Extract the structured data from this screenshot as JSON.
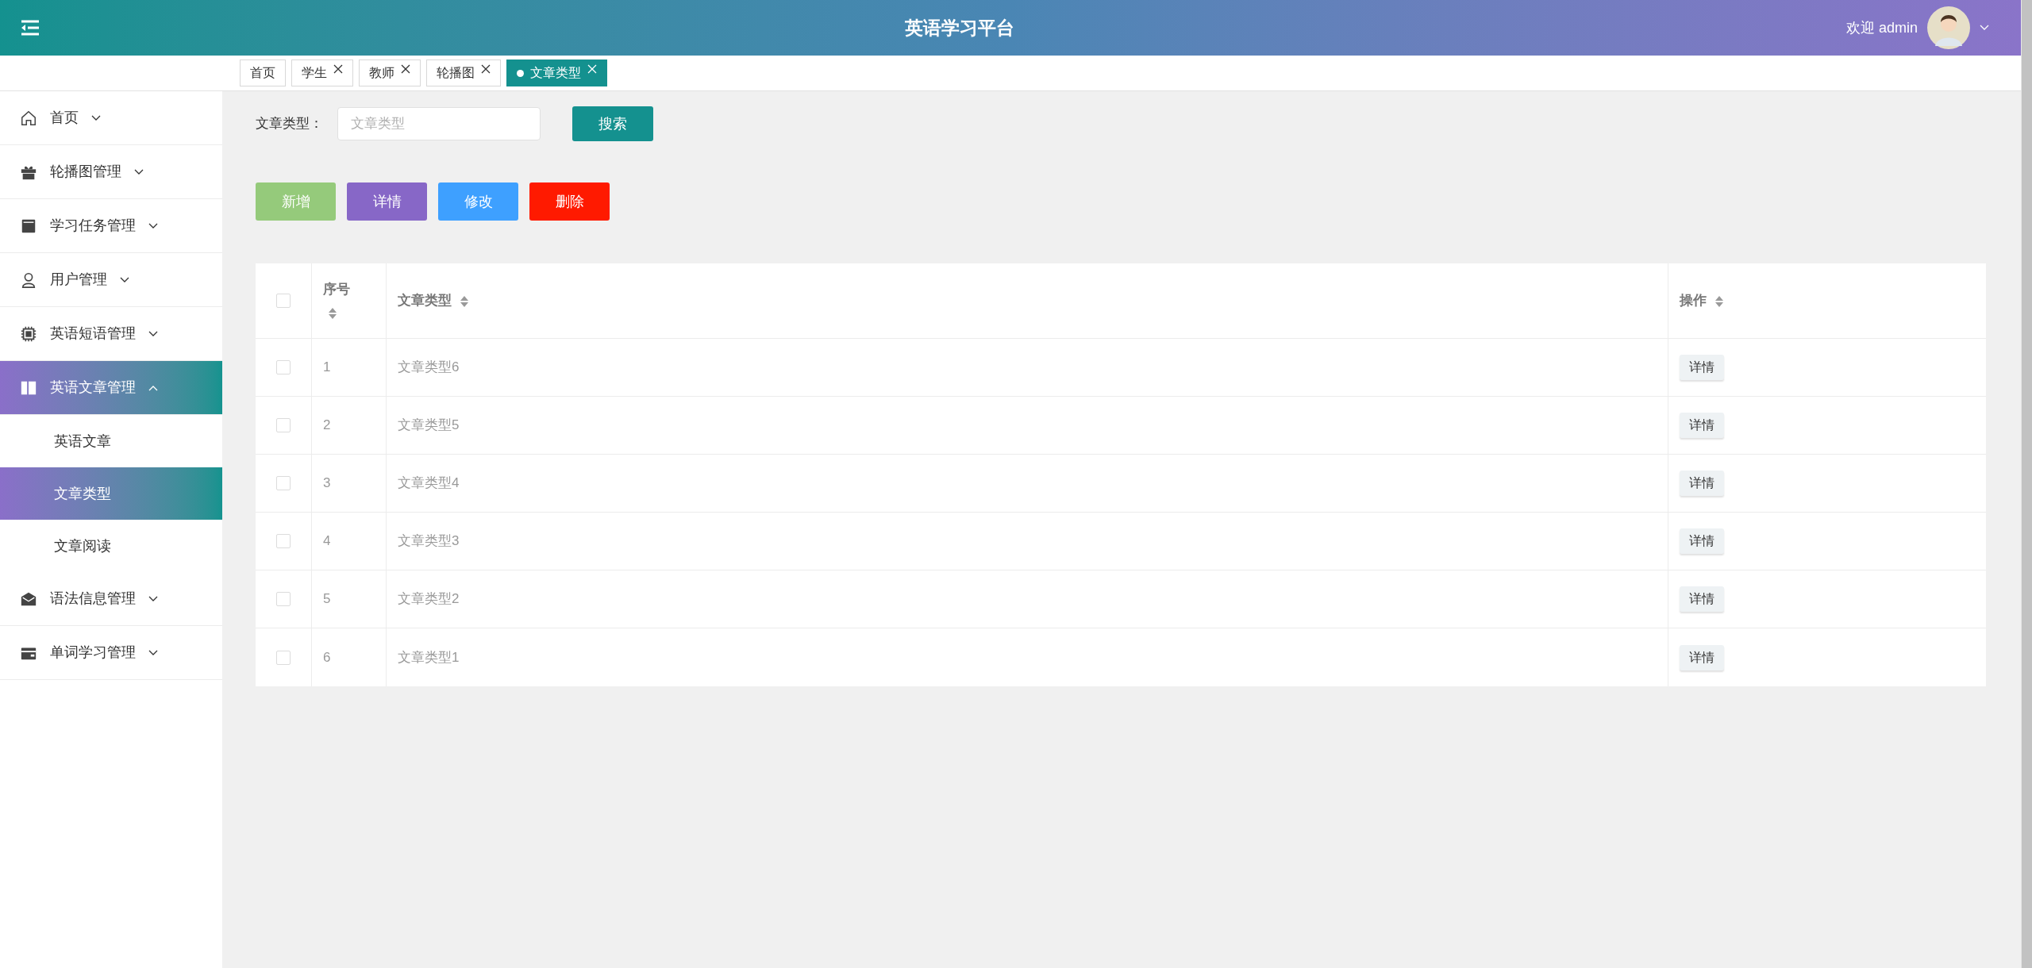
{
  "header": {
    "title": "英语学习平台",
    "welcome": "欢迎 admin"
  },
  "tabs": [
    {
      "label": "首页",
      "closable": false,
      "selected": false
    },
    {
      "label": "学生",
      "closable": true,
      "selected": false
    },
    {
      "label": "教师",
      "closable": true,
      "selected": false
    },
    {
      "label": "轮播图",
      "closable": true,
      "selected": false
    },
    {
      "label": "文章类型",
      "closable": true,
      "selected": true
    }
  ],
  "sidebar": {
    "items": [
      {
        "label": "首页",
        "kind": "home",
        "expanded": false,
        "selected": false
      },
      {
        "label": "轮播图管理",
        "kind": "gift",
        "expanded": false,
        "selected": false
      },
      {
        "label": "学习任务管理",
        "kind": "book",
        "expanded": false,
        "selected": false
      },
      {
        "label": "用户管理",
        "kind": "user",
        "expanded": false,
        "selected": false
      },
      {
        "label": "英语短语管理",
        "kind": "chip",
        "expanded": false,
        "selected": false
      },
      {
        "label": "英语文章管理",
        "kind": "columns",
        "expanded": true,
        "selected": true,
        "children": [
          {
            "label": "英语文章",
            "selected": false
          },
          {
            "label": "文章类型",
            "selected": true
          },
          {
            "label": "文章阅读",
            "selected": false
          }
        ]
      },
      {
        "label": "语法信息管理",
        "kind": "mail",
        "expanded": false,
        "selected": false
      },
      {
        "label": "单词学习管理",
        "kind": "wallet",
        "expanded": false,
        "selected": false
      }
    ]
  },
  "search": {
    "label": "文章类型：",
    "placeholder": "文章类型",
    "button": "搜索"
  },
  "actions": [
    {
      "label": "新增",
      "kind": "add"
    },
    {
      "label": "详情",
      "kind": "detail"
    },
    {
      "label": "修改",
      "kind": "edit"
    },
    {
      "label": "删除",
      "kind": "delete"
    }
  ],
  "table": {
    "all_checked": false,
    "columns": [
      {
        "label": "序号",
        "sortable": true
      },
      {
        "label": "文章类型",
        "sortable": true
      },
      {
        "label": "操作",
        "sortable": true
      }
    ],
    "rows": [
      {
        "checked": false,
        "cells": [
          "1",
          "文章类型6"
        ],
        "action": "详情"
      },
      {
        "checked": false,
        "cells": [
          "2",
          "文章类型5"
        ],
        "action": "详情"
      },
      {
        "checked": false,
        "cells": [
          "3",
          "文章类型4"
        ],
        "action": "详情"
      },
      {
        "checked": false,
        "cells": [
          "4",
          "文章类型3"
        ],
        "action": "详情"
      },
      {
        "checked": false,
        "cells": [
          "5",
          "文章类型2"
        ],
        "action": "详情"
      },
      {
        "checked": false,
        "cells": [
          "6",
          "文章类型1"
        ],
        "action": "详情"
      }
    ]
  }
}
